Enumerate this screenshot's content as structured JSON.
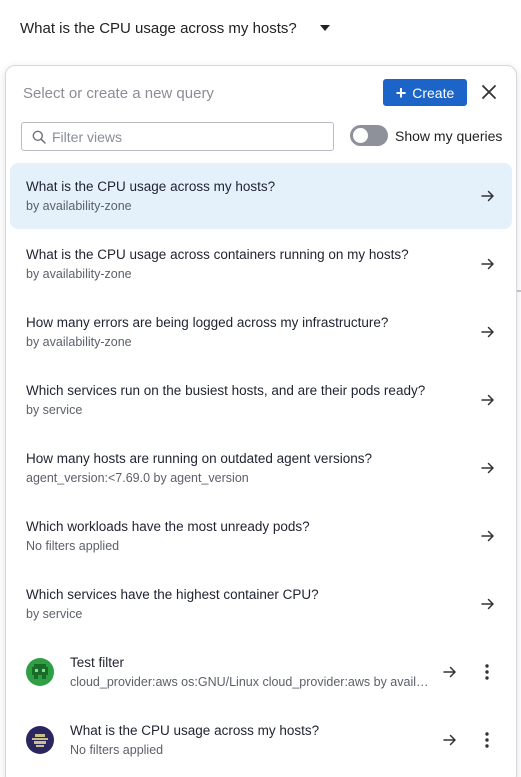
{
  "header": {
    "title": "What is the CPU usage across my hosts?"
  },
  "panel": {
    "prompt": "Select or create a new query",
    "create_label": "Create",
    "filter_placeholder": "Filter views",
    "toggle_label": "Show my queries",
    "toggle_on": false
  },
  "queries": [
    {
      "title": "What is the CPU usage across my hosts?",
      "subtitle": "by availability-zone",
      "selected": true
    },
    {
      "title": "What is the CPU usage across containers running on my hosts?",
      "subtitle": "by availability-zone"
    },
    {
      "title": "How many errors are being logged across my infrastructure?",
      "subtitle": "by availability-zone"
    },
    {
      "title": "Which services run on the busiest hosts, and are their pods ready?",
      "subtitle": "by service"
    },
    {
      "title": "How many hosts are running on outdated agent versions?",
      "subtitle": "agent_version:<7.69.0 by agent_version"
    },
    {
      "title": "Which workloads have the most unready pods?",
      "subtitle": "No filters applied"
    },
    {
      "title": "Which services have the highest container CPU?",
      "subtitle": "by service"
    }
  ],
  "my_queries": [
    {
      "title": "Test filter",
      "subtitle": "cloud_provider:aws os:GNU/Linux cloud_provider:aws by availability-zone",
      "avatar_color": "#2ea043"
    },
    {
      "title": "What is the CPU usage across my hosts?",
      "subtitle": "No filters applied",
      "avatar_color": "#2b2560"
    }
  ],
  "colors": {
    "accent": "#1c64c7",
    "selected_bg": "#e4f1fb"
  }
}
